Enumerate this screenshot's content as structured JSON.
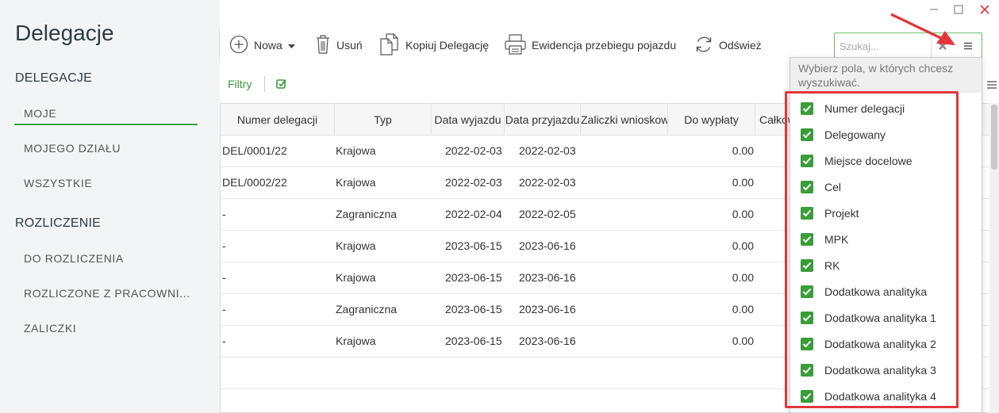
{
  "window": {
    "minimize_glyph": "–",
    "maximize_glyph": "☐",
    "close_glyph": "✕"
  },
  "sidebar": {
    "title": "Delegacje",
    "sections": [
      {
        "heading": "DELEGACJE",
        "items": [
          "MOJE",
          "MOJEGO DZIAŁU",
          "WSZYSTKIE"
        ]
      },
      {
        "heading": "ROZLICZENIE",
        "items": [
          "DO ROZLICZENIA",
          "ROZLICZONE Z PRACOWNI...",
          "ZALICZKI"
        ]
      }
    ],
    "active_item": "MOJE"
  },
  "toolbar": {
    "new_label": "Nowa",
    "delete_label": "Usuń",
    "copy_label": "Kopiuj Delegację",
    "vehicle_label": "Ewidencja przebiegu pojazdu",
    "refresh_label": "Odśwież"
  },
  "filters": {
    "label": "Filtry"
  },
  "search": {
    "placeholder": "Szukaj..."
  },
  "table": {
    "columns": [
      "Numer delegacji",
      "Typ",
      "Data wyjazdu",
      "Data przyjazdu",
      "Zaliczki wnioskow",
      "Do wypłaty",
      "Całkow"
    ],
    "rows": [
      [
        "DEL/0001/22",
        "Krajowa",
        "2022-02-03",
        "2022-02-03",
        "",
        "0.00"
      ],
      [
        "DEL/0002/22",
        "Krajowa",
        "2022-02-03",
        "2022-02-03",
        "",
        "0.00"
      ],
      [
        "-",
        "Zagraniczna",
        "2022-02-04",
        "2022-02-05",
        "",
        "0.00"
      ],
      [
        "-",
        "Krajowa",
        "2023-06-15",
        "2023-06-16",
        "",
        "0.00"
      ],
      [
        "-",
        "Krajowa",
        "2023-06-15",
        "2023-06-16",
        "",
        "0.00"
      ],
      [
        "-",
        "Zagraniczna",
        "2023-06-15",
        "2023-06-16",
        "",
        "0.00"
      ],
      [
        "-",
        "Krajowa",
        "2023-06-15",
        "2023-06-16",
        "",
        "0.00"
      ]
    ]
  },
  "search_fields_popup": {
    "hint": "Wybierz pola, w których chcesz wyszukiwać.",
    "options": [
      {
        "label": "Numer delegacji",
        "checked": true
      },
      {
        "label": "Delegowany",
        "checked": true
      },
      {
        "label": "Miejsce docelowe",
        "checked": true
      },
      {
        "label": "Cel",
        "checked": true
      },
      {
        "label": "Projekt",
        "checked": true
      },
      {
        "label": "MPK",
        "checked": true
      },
      {
        "label": "RK",
        "checked": true
      },
      {
        "label": "Dodatkowa analityka",
        "checked": true
      },
      {
        "label": "Dodatkowa analityka 1",
        "checked": true
      },
      {
        "label": "Dodatkowa analityka 2",
        "checked": true
      },
      {
        "label": "Dodatkowa analityka 3",
        "checked": true
      },
      {
        "label": "Dodatkowa analityka 4",
        "checked": true
      }
    ]
  },
  "colors": {
    "accent": "#3aa23a",
    "highlight": "#e2363b",
    "checkbox": "#3a9d3a"
  }
}
